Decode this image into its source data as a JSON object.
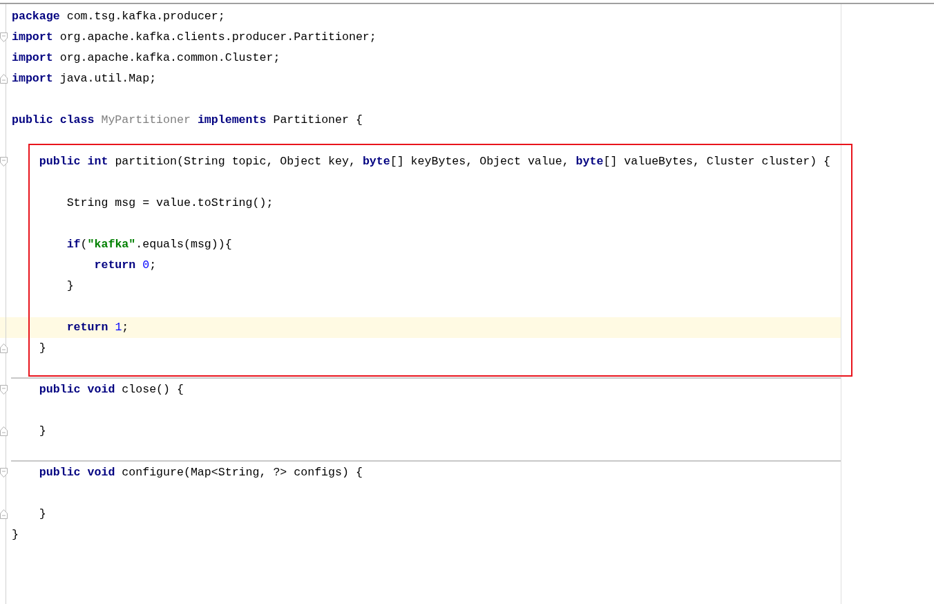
{
  "editor": {
    "lines": [
      {
        "kind": "code",
        "tokens": [
          {
            "kind": "keyword",
            "text": "package"
          },
          {
            "kind": "plain",
            "text": " com.tsg.kafka.producer;"
          }
        ]
      },
      {
        "kind": "code",
        "fold_open": true,
        "tokens": [
          {
            "kind": "keyword",
            "text": "import"
          },
          {
            "kind": "plain",
            "text": " org.apache.kafka.clients.producer.Partitioner;"
          }
        ]
      },
      {
        "kind": "code",
        "tokens": [
          {
            "kind": "keyword",
            "text": "import"
          },
          {
            "kind": "plain",
            "text": " org.apache.kafka.common.Cluster;"
          }
        ]
      },
      {
        "kind": "code",
        "fold_close": true,
        "tokens": [
          {
            "kind": "keyword",
            "text": "import"
          },
          {
            "kind": "plain",
            "text": " java.util.Map;"
          }
        ]
      },
      {
        "kind": "blank"
      },
      {
        "kind": "code",
        "tokens": [
          {
            "kind": "keyword",
            "text": "public class "
          },
          {
            "kind": "unused",
            "text": "MyPartitioner "
          },
          {
            "kind": "keyword",
            "text": "implements"
          },
          {
            "kind": "plain",
            "text": " Partitioner {"
          }
        ]
      },
      {
        "kind": "blank"
      },
      {
        "kind": "code",
        "fold_open": true,
        "tokens": [
          {
            "kind": "keyword",
            "text": "    public int"
          },
          {
            "kind": "plain",
            "text": " partition(String topic, Object key, "
          },
          {
            "kind": "keyword",
            "text": "byte"
          },
          {
            "kind": "plain",
            "text": "[] keyBytes, Object value, "
          },
          {
            "kind": "keyword",
            "text": "byte"
          },
          {
            "kind": "plain",
            "text": "[] valueBytes, Cluster cluster) {"
          }
        ]
      },
      {
        "kind": "blank"
      },
      {
        "kind": "code",
        "tokens": [
          {
            "kind": "plain",
            "text": "        String msg = value.toString();"
          }
        ]
      },
      {
        "kind": "blank"
      },
      {
        "kind": "code",
        "tokens": [
          {
            "kind": "keyword",
            "text": "        if"
          },
          {
            "kind": "plain",
            "text": "("
          },
          {
            "kind": "string",
            "text": "\"kafka\""
          },
          {
            "kind": "plain",
            "text": ".equals(msg)){"
          }
        ]
      },
      {
        "kind": "code",
        "tokens": [
          {
            "kind": "keyword",
            "text": "            return "
          },
          {
            "kind": "number",
            "text": "0"
          },
          {
            "kind": "plain",
            "text": ";"
          }
        ]
      },
      {
        "kind": "code",
        "tokens": [
          {
            "kind": "plain",
            "text": "        }"
          }
        ]
      },
      {
        "kind": "blank"
      },
      {
        "kind": "code",
        "current": true,
        "tokens": [
          {
            "kind": "keyword",
            "text": "        return "
          },
          {
            "kind": "number",
            "text": "1"
          },
          {
            "kind": "plain",
            "text": ";"
          }
        ]
      },
      {
        "kind": "code",
        "fold_close": true,
        "tokens": [
          {
            "kind": "plain",
            "text": "    }"
          }
        ]
      },
      {
        "kind": "blank",
        "separator": true
      },
      {
        "kind": "code",
        "fold_open": true,
        "tokens": [
          {
            "kind": "keyword",
            "text": "    public void"
          },
          {
            "kind": "plain",
            "text": " close() {"
          }
        ]
      },
      {
        "kind": "blank"
      },
      {
        "kind": "code",
        "fold_close": true,
        "tokens": [
          {
            "kind": "plain",
            "text": "    }"
          }
        ]
      },
      {
        "kind": "blank",
        "separator": true
      },
      {
        "kind": "code",
        "fold_open": true,
        "tokens": [
          {
            "kind": "keyword",
            "text": "    public void"
          },
          {
            "kind": "plain",
            "text": " configure(Map<String, ?> configs) {"
          }
        ]
      },
      {
        "kind": "blank"
      },
      {
        "kind": "code",
        "fold_close": true,
        "tokens": [
          {
            "kind": "plain",
            "text": "    }"
          }
        ]
      },
      {
        "kind": "code",
        "tokens": [
          {
            "kind": "plain",
            "text": "}"
          }
        ]
      }
    ]
  }
}
